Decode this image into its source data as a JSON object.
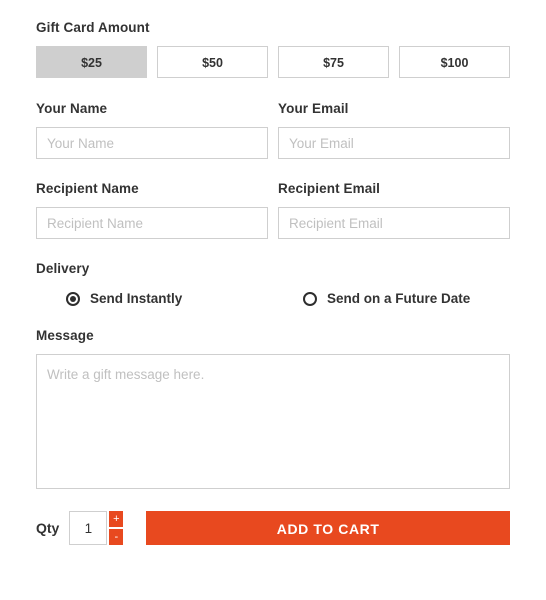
{
  "form": {
    "amount": {
      "label": "Gift Card Amount",
      "options": [
        {
          "label": "$25",
          "selected": true
        },
        {
          "label": "$50",
          "selected": false
        },
        {
          "label": "$75",
          "selected": false
        },
        {
          "label": "$100",
          "selected": false
        }
      ]
    },
    "your_name": {
      "label": "Your Name",
      "placeholder": "Your Name",
      "value": ""
    },
    "your_email": {
      "label": "Your Email",
      "placeholder": "Your Email",
      "value": ""
    },
    "recipient_name": {
      "label": "Recipient Name",
      "placeholder": "Recipient Name",
      "value": ""
    },
    "recipient_email": {
      "label": "Recipient Email",
      "placeholder": "Recipient Email",
      "value": ""
    },
    "delivery": {
      "label": "Delivery",
      "options": [
        {
          "label": "Send Instantly",
          "selected": true
        },
        {
          "label": "Send on a Future Date",
          "selected": false
        }
      ]
    },
    "message": {
      "label": "Message",
      "placeholder": "Write a gift message here.",
      "value": ""
    },
    "cart": {
      "qty_label": "Qty",
      "qty_value": "1",
      "increment_label": "+",
      "decrement_label": "-",
      "add_to_cart_label": "ADD TO CART"
    }
  },
  "colors": {
    "accent": "#e8491f",
    "selected_swatch": "#cfcfcf",
    "border": "#cfcfcf",
    "text": "#333333",
    "placeholder": "#c0c0c0"
  }
}
